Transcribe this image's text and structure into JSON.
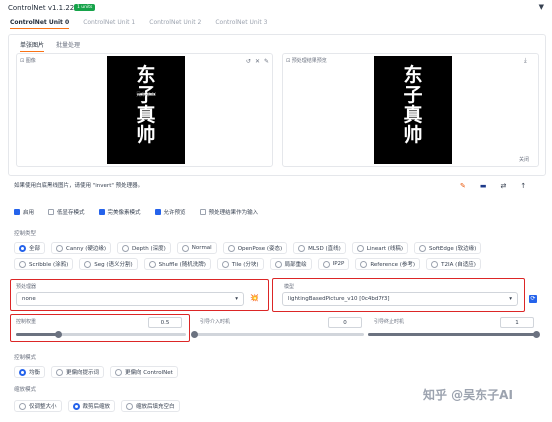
{
  "header": {
    "title": "ControlNet v1.1.224",
    "badge": "1 units",
    "collapse_icon": "triangle-down"
  },
  "unit_tabs": [
    "ControlNet Unit 0",
    "ControlNet Unit 1",
    "ControlNet Unit 2",
    "ControlNet Unit 3"
  ],
  "image_tabs": [
    "单张图片",
    "批量处理"
  ],
  "left_image": {
    "label": "图像",
    "chars": [
      "东",
      "子",
      "真",
      "帅"
    ],
    "watermark": "吴东子AI"
  },
  "right_image": {
    "label": "预处理结果预览",
    "chars": [
      "东",
      "子",
      "真",
      "帅"
    ],
    "corner_text": "关闭"
  },
  "hint": "如果使用白底黑线图片，请使用 \"invert\" 预处理器。",
  "checkboxes": [
    {
      "label": "启用",
      "checked": true
    },
    {
      "label": "低显存模式",
      "checked": false
    },
    {
      "label": "完美像素模式",
      "checked": true
    },
    {
      "label": "允许预览",
      "checked": true
    },
    {
      "label": "预处理结果作为输入",
      "checked": false
    }
  ],
  "control_type": {
    "title": "控制类型",
    "options": [
      "全部",
      "Canny (硬边缘)",
      "Depth (深度)",
      "Normal",
      "OpenPose (姿态)",
      "MLSD (直线)",
      "Lineart (线稿)",
      "SoftEdge (软边缘)",
      "Scribble (涂鸦)",
      "Seg (语义分割)",
      "Shuffle (随机洗牌)",
      "Tile (分块)",
      "局部重绘",
      "IP2P",
      "Reference (参考)",
      "T2IA (自适应)"
    ],
    "selected": "全部"
  },
  "preprocessor": {
    "label": "预处理器",
    "value": "none",
    "fire_icon": "💥"
  },
  "model": {
    "label": "模型",
    "value": "lightingBasedPicture_v10 [0c4bd7f3]",
    "refresh_icon": "⟳"
  },
  "sliders": {
    "control_weight": {
      "label": "控制权重",
      "value": "0.5",
      "fraction": 0.25
    },
    "start": {
      "label": "引导介入时机",
      "value": "0",
      "fraction": 0.0
    },
    "end": {
      "label": "引导终止时机",
      "value": "1",
      "fraction": 1.0
    }
  },
  "control_mode": {
    "title": "控制模式",
    "options": [
      "均衡",
      "更偏向提示词",
      "更偏向 ControlNet"
    ],
    "selected": "均衡"
  },
  "resize_mode": {
    "title": "缩放模式",
    "options": [
      "仅调整大小",
      "裁剪后缩放",
      "缩放后填充空白"
    ],
    "selected": "裁剪后缩放"
  },
  "tool_icons": [
    "pencil-icon",
    "camera-icon",
    "swap-icon",
    "arrow-up-icon"
  ],
  "watermark_brand": "知乎 @吴东子AI"
}
